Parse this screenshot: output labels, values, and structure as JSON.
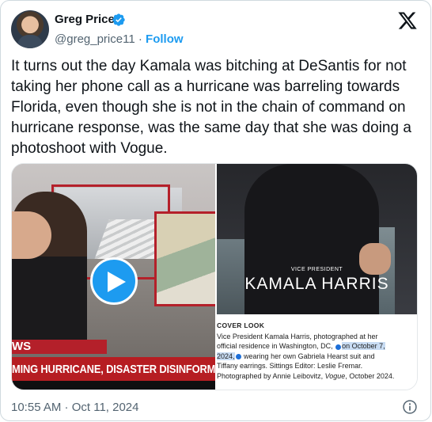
{
  "author": {
    "name": "Greg Price",
    "handle": "@greg_price11",
    "separator": "·",
    "follow_label": "Follow"
  },
  "icons": {
    "verified": "verified-badge-icon",
    "brand": "x-logo-icon",
    "play": "play-icon",
    "info": "info-icon"
  },
  "colors": {
    "accent": "#1d9bf0",
    "text": "#0f1419",
    "secondary_text": "#536471",
    "news_red": "#b61d22"
  },
  "tweet": {
    "text": "It turns out the day Kamala was bitching at DeSantis for not taking her phone call as a hurricane was barreling towards Florida, even though she is not in the chain of command on hurricane response, was the same day that she was doing a photoshoot with Vogue."
  },
  "media": {
    "video": {
      "chyron_top": "WS",
      "chyron": "MING HURRICANE, DISASTER DISINFORMATIO"
    },
    "magazine": {
      "kicker": "VICE PRESIDENT",
      "headline": "KAMALA HARRIS",
      "section": "COVER LOOK",
      "caption_1": "Vice President Kamala Harris, photographed at her official residence in Washington, DC,",
      "caption_highlight": "on October 7, 2024,",
      "caption_2": "wearing her own Gabriela Hearst suit and Tiffany earrings. Sittings Editor: Leslie Fremar. Photographed by Annie Leibovitz,",
      "caption_italic": "Vogue",
      "caption_3": ", October 2024."
    }
  },
  "footer": {
    "timestamp": "10:55 AM · Oct 11, 2024"
  }
}
